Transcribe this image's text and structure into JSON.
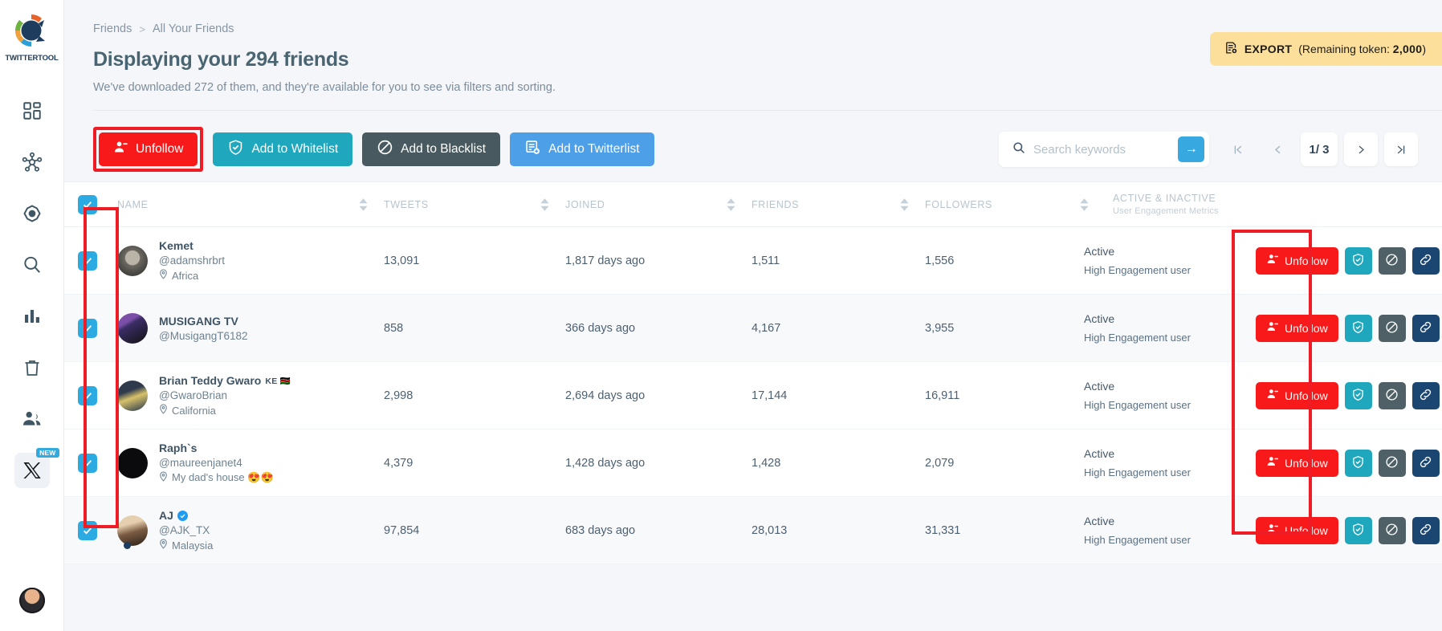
{
  "brand": {
    "name": "TWITTERTOOL",
    "logo_colors": [
      "#e8622a",
      "#6cb33f",
      "#f0a03c",
      "#2c9fd8",
      "#1d3c5e"
    ]
  },
  "sidebar": {
    "items": [
      {
        "name": "dashboard",
        "icon": "grid-icon"
      },
      {
        "name": "network",
        "icon": "network-icon"
      },
      {
        "name": "target",
        "icon": "target-icon"
      },
      {
        "name": "search",
        "icon": "search-icon"
      },
      {
        "name": "analytics",
        "icon": "bar-chart-icon"
      },
      {
        "name": "trash",
        "icon": "trash-icon"
      },
      {
        "name": "friends",
        "icon": "users-icon"
      },
      {
        "name": "x-platform",
        "icon": "x-logo-icon",
        "badge": "NEW"
      }
    ],
    "account_avatar": "user-avatar"
  },
  "breadcrumb": {
    "parent": "Friends",
    "separator": ">",
    "current": "All Your Friends"
  },
  "header": {
    "title": "Displaying your 294 friends",
    "subtitle": "We've downloaded 272 of them, and they're available for you to see via filters and sorting."
  },
  "export": {
    "label": "EXPORT",
    "token_text": "(Remaining token: ",
    "token_value": "2,000",
    "token_suffix": ")"
  },
  "toolbar": {
    "unfollow": "Unfollow",
    "whitelist": "Add to Whitelist",
    "blacklist": "Add to Blacklist",
    "twitterlist": "Add to Twitterlist"
  },
  "search": {
    "placeholder": "Search keywords",
    "value": "",
    "submit": "→"
  },
  "pagination": {
    "first": "|<",
    "prev": "<",
    "current": "1",
    "slash": "/",
    "total": "3",
    "next": ">",
    "last": ">|"
  },
  "table": {
    "headers": {
      "name": "NAME",
      "tweets": "TWEETS",
      "joined": "JOINED",
      "friends": "FRIENDS",
      "followers": "FOLLOWERS",
      "activity": "ACTIVE & INACTIVE",
      "activity_sub": "User Engagement Metrics"
    },
    "row_actions": {
      "unfollow": "Unfollow",
      "whitelist": "whitelist-icon",
      "blacklist": "blacklist-icon",
      "link": "link-icon"
    },
    "rows": [
      {
        "checked": true,
        "avatar": "av1",
        "name": "Kemet",
        "flag": "",
        "verified": false,
        "handle": "@adamshrbrt",
        "location": "Africa",
        "tweets": "13,091",
        "joined": "1,817 days ago",
        "friends": "1,511",
        "followers": "1,556",
        "status": "Active",
        "engagement": "High Engagement user"
      },
      {
        "checked": true,
        "avatar": "av2",
        "name": "MUSIGANG TV",
        "flag": "",
        "verified": false,
        "handle": "@MusigangT6182",
        "location": "",
        "tweets": "858",
        "joined": "366 days ago",
        "friends": "4,167",
        "followers": "3,955",
        "status": "Active",
        "engagement": "High Engagement user"
      },
      {
        "checked": true,
        "avatar": "av3",
        "name": "Brian Teddy Gwaro",
        "flag": "KE 🇰🇪",
        "verified": false,
        "handle": "@GwaroBrian",
        "location": "California",
        "tweets": "2,998",
        "joined": "2,694 days ago",
        "friends": "17,144",
        "followers": "16,911",
        "status": "Active",
        "engagement": "High Engagement user"
      },
      {
        "checked": true,
        "avatar": "av4",
        "name": "Raph`s",
        "flag": "",
        "verified": false,
        "handle": "@maureenjanet4",
        "location": "My dad's house 😍😍",
        "tweets": "4,379",
        "joined": "1,428 days ago",
        "friends": "1,428",
        "followers": "2,079",
        "status": "Active",
        "engagement": "High Engagement user"
      },
      {
        "checked": true,
        "avatar": "av5",
        "name": "AJ",
        "flag": "",
        "verified": true,
        "handle": "@AJK_TX",
        "location": "Malaysia",
        "tweets": "97,854",
        "joined": "683 days ago",
        "friends": "28,013",
        "followers": "31,331",
        "status": "Active",
        "engagement": "High Engagement user"
      }
    ]
  },
  "colors": {
    "red": "#f81a1a",
    "teal": "#1fa7bd",
    "dark": "#485a5f",
    "blue": "#4d9fe8",
    "navy": "#1c4672",
    "checkbox": "#2cabe3",
    "export": "#fbdf9a",
    "annotation": "#ee1c25"
  }
}
